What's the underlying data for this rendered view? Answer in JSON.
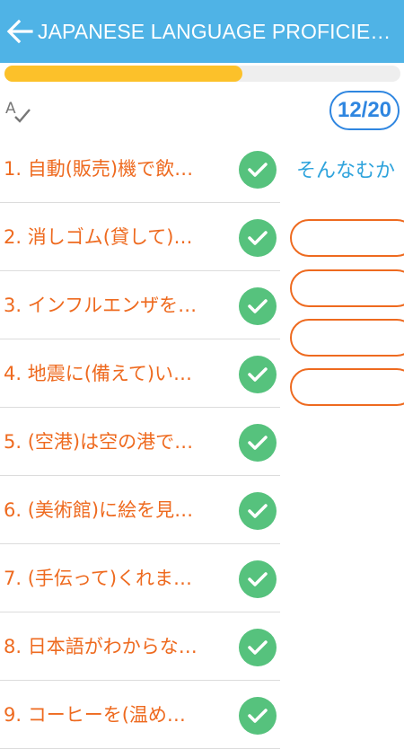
{
  "header": {
    "title": "JAPANESE LANGUAGE PROFICIEN…",
    "back_icon": "arrow-left-icon",
    "background_color": "#4fb3e6"
  },
  "progress": {
    "fraction": 0.6,
    "fill_color": "#fcc12a",
    "track_color": "#eeeeee"
  },
  "toolbar": {
    "spell_icon": "spell-check-icon",
    "counter": "12/20"
  },
  "questions": [
    {
      "number": "1.",
      "text": "1.  自動(販売)機で飲…",
      "status": "check-icon"
    },
    {
      "number": "2.",
      "text": "2.  消しゴム(貸して)…",
      "status": "check-icon"
    },
    {
      "number": "3.",
      "text": "3.  インフルエンザを…",
      "status": "check-icon"
    },
    {
      "number": "4.",
      "text": "4.  地震に(備えて)い…",
      "status": "check-icon"
    },
    {
      "number": "5.",
      "text": "5.  (空港)は空の港で…",
      "status": "check-icon"
    },
    {
      "number": "6.",
      "text": "6.  (美術館)に絵を見…",
      "status": "check-icon"
    },
    {
      "number": "7.",
      "text": "7.  (手伝って)くれま…",
      "status": "check-icon"
    },
    {
      "number": "8.",
      "text": "8.  日本語がわからな…",
      "status": "check-icon"
    },
    {
      "number": "9.",
      "text": "9.  コーヒーを(温め…",
      "status": "check-icon"
    }
  ],
  "answer_panel": {
    "prompt": "そんなむか",
    "options": [
      "",
      "",
      "",
      ""
    ]
  },
  "colors": {
    "question_text": "#ee6a1f",
    "check_green": "#56c27d",
    "counter_blue": "#2f86e0",
    "answer_blue": "#2ea3dc",
    "option_border": "#ee6a1f"
  }
}
